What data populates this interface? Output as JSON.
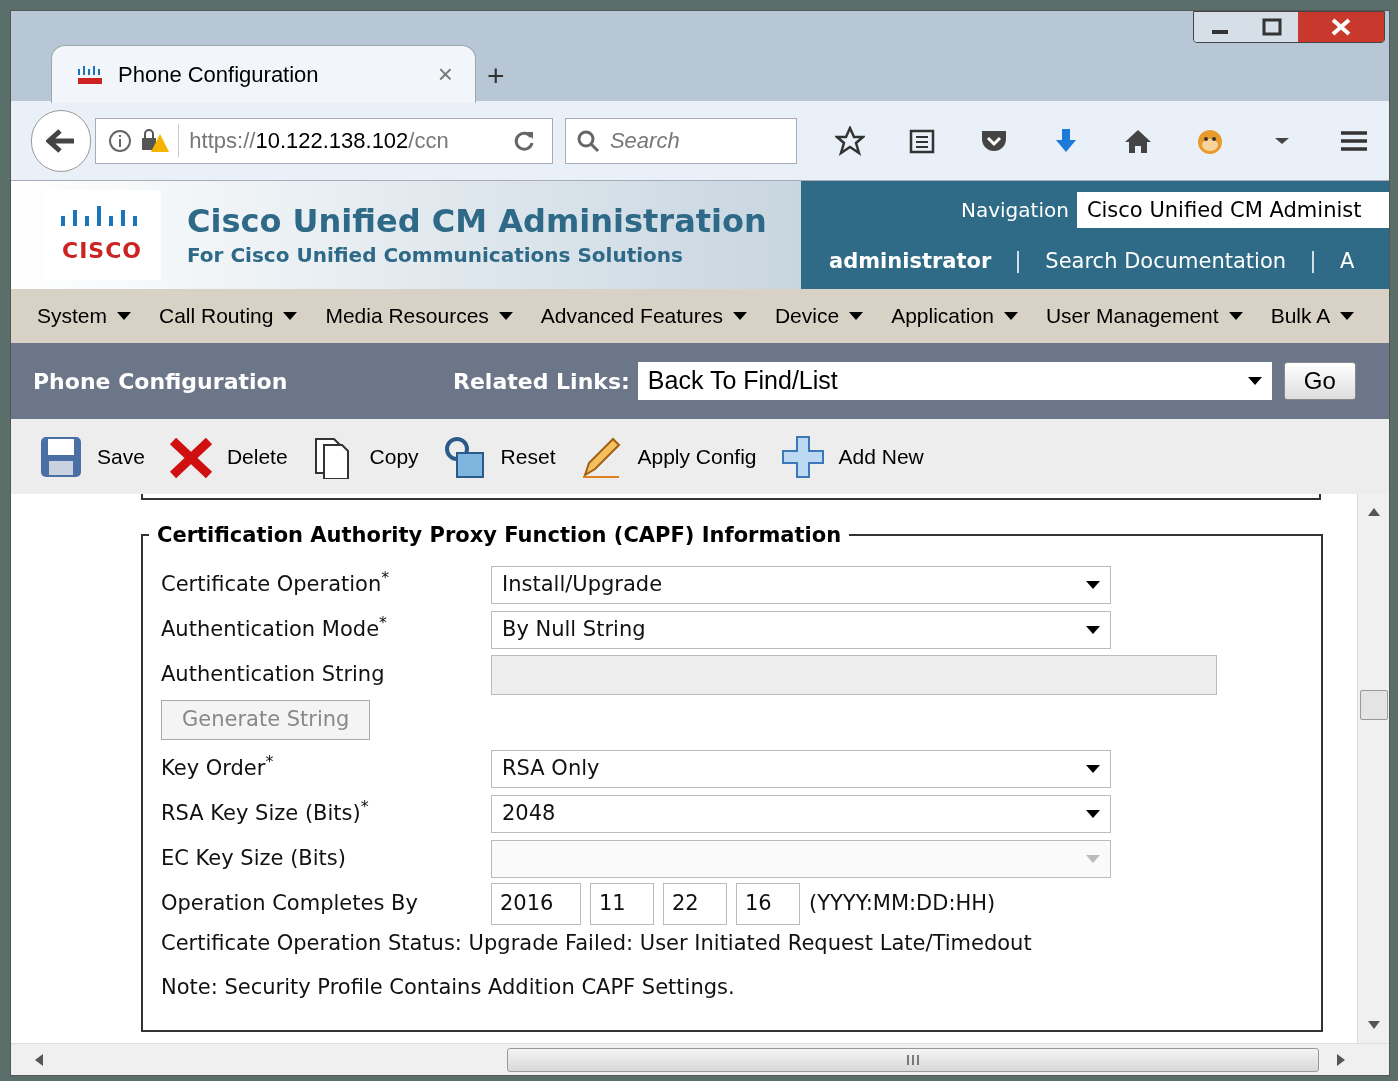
{
  "browser": {
    "tab": {
      "title": "Phone Configuration",
      "close": "×",
      "selected": true
    },
    "new_tab": "+",
    "url": {
      "scheme": "https://",
      "host": "10.122.138.102",
      "path": "/ccn"
    },
    "search": {
      "placeholder": "Search"
    }
  },
  "header": {
    "title": "Cisco Unified CM Administration",
    "subtitle": "For Cisco Unified Communications Solutions",
    "logo_word": "CISCO",
    "navigation_label": "Navigation",
    "navigation_value": "Cisco Unified CM Administ",
    "user": "administrator",
    "links": [
      "Search Documentation",
      "A"
    ]
  },
  "menu": [
    "System",
    "Call Routing",
    "Media Resources",
    "Advanced Features",
    "Device",
    "Application",
    "User Management",
    "Bulk A"
  ],
  "page_bar": {
    "title": "Phone Configuration",
    "related_label": "Related Links:",
    "related_value": "Back To Find/List",
    "go": "Go"
  },
  "toolbar": [
    {
      "kind": "save",
      "label": "Save"
    },
    {
      "kind": "delete",
      "label": "Delete"
    },
    {
      "kind": "copy",
      "label": "Copy"
    },
    {
      "kind": "reset",
      "label": "Reset"
    },
    {
      "kind": "apply",
      "label": "Apply Config"
    },
    {
      "kind": "add",
      "label": "Add New"
    }
  ],
  "section": {
    "legend": "Certification Authority Proxy Function (CAPF) Information",
    "fields": [
      {
        "kind": "select",
        "label": "Certificate Operation$^{*}$",
        "value": "Install/Upgrade",
        "disabled": false
      },
      {
        "kind": "select",
        "label": "Authentication Mode$^{*}$",
        "value": "By Null String",
        "disabled": false
      },
      {
        "kind": "input",
        "label": "Authentication String",
        "disabled": true
      },
      {
        "kind": "button",
        "label": "Generate String",
        "disabled": true
      },
      {
        "kind": "select",
        "label": "Key Order$^{*}$",
        "value": "RSA Only",
        "disabled": false
      },
      {
        "kind": "select",
        "label": "RSA Key Size (Bits)$^{*}$",
        "value": "2048",
        "disabled": false
      },
      {
        "kind": "select",
        "label": "EC Key Size (Bits)",
        "disabled": true
      },
      {
        "kind": "date",
        "label": "Operation Completes By",
        "values": [
          "2016",
          "11",
          "22",
          "16"
        ],
        "format": "(YYYY:MM:DD:HH)"
      }
    ],
    "status": "Certificate Operation Status: Upgrade Failed: User Initiated Request Late/Timedout",
    "note": "Note: Security Profile Contains Addition CAPF Settings."
  }
}
